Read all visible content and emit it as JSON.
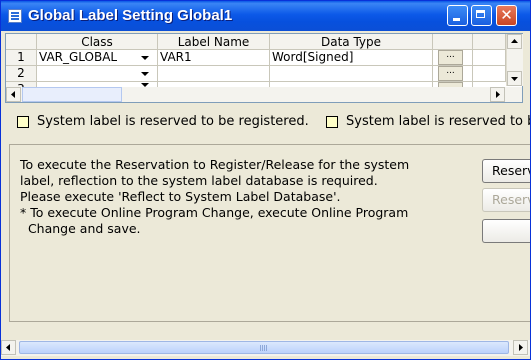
{
  "window": {
    "title": "Global Label Setting Global1"
  },
  "grid": {
    "columns": [
      "Class",
      "Label Name",
      "Data Type"
    ],
    "rows": [
      {
        "num": "1",
        "class": "VAR_GLOBAL",
        "label": "VAR1",
        "type": "Word[Signed]",
        "button": "..."
      },
      {
        "num": "2",
        "class": "",
        "label": "",
        "type": "",
        "button": "..."
      },
      {
        "num": "3",
        "class": "",
        "label": "",
        "type": "",
        "button": "..."
      }
    ]
  },
  "legend": {
    "item1": "System label is reserved to be registered.",
    "item2": "System label is reserved to b"
  },
  "message": "To execute the Reservation to Register/Release for the system\nlabel, reflection to the system label database is required.\nPlease execute 'Reflect to System Label Database'.\n* To execute Online Program Change, execute Online Program\n  Change and save.",
  "buttons": {
    "reserve1": "Reservat",
    "reserve2": "Reserva"
  },
  "colors": {
    "titlebar": "#0c59e8",
    "legend_swatch": "#ffffc8",
    "window_bg": "#ece9d8"
  },
  "icons": [
    "app-icon",
    "minimize-icon",
    "maximize-icon",
    "close-icon",
    "chevron-down-icon",
    "arrow-left-icon",
    "arrow-right-icon",
    "arrow-up-icon",
    "arrow-down-icon"
  ]
}
